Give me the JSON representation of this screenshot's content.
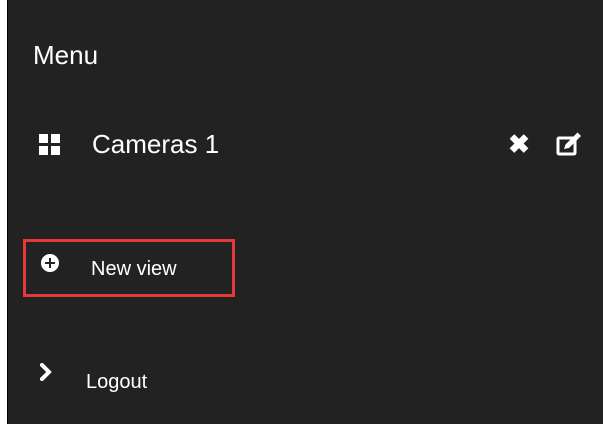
{
  "menu": {
    "title": "Menu"
  },
  "view_item": {
    "icon": "grid-icon",
    "label": "Cameras 1",
    "close_icon": "close-icon",
    "edit_icon": "edit-icon"
  },
  "actions": {
    "new_view": {
      "icon": "plus-circle-icon",
      "label": "New view",
      "highlight_color": "#e53935"
    },
    "logout": {
      "icon": "chevron-right-icon",
      "label": "Logout"
    }
  },
  "colors": {
    "panel_background": "#222222",
    "text": "#ffffff",
    "highlight": "#e53935"
  }
}
